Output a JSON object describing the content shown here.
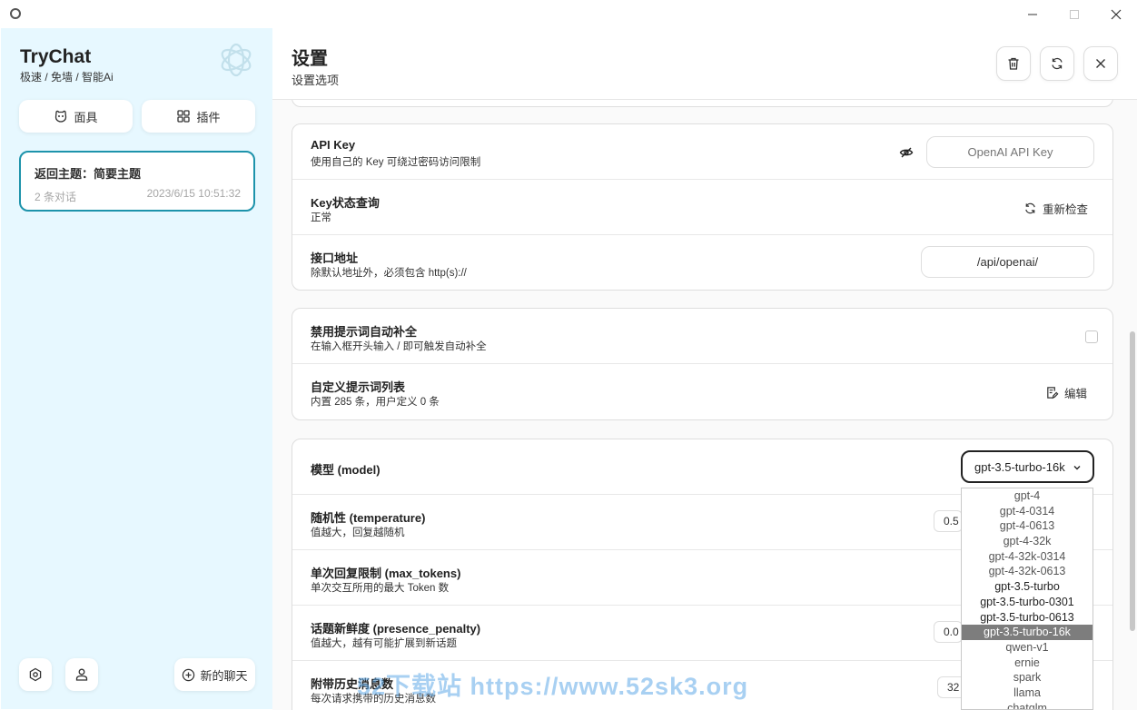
{
  "sidebar": {
    "title": "TryChat",
    "subtitle": "极速 / 免墙 / 智能Ai",
    "mask_label": "面具",
    "plugin_label": "插件",
    "chat": {
      "title": "返回主题：简要主题",
      "count": "2 条对话",
      "time": "2023/6/15 10:51:32"
    },
    "new_chat_label": "新的聊天"
  },
  "header": {
    "title": "设置",
    "subtitle": "设置选项"
  },
  "settings": {
    "api_key": {
      "title": "API Key",
      "desc": "使用自己的 Key 可绕过密码访问限制",
      "placeholder": "OpenAI API Key"
    },
    "key_status": {
      "title": "Key状态查询",
      "desc": "正常",
      "action": "重新检查"
    },
    "endpoint": {
      "title": "接口地址",
      "desc": "除默认地址外，必须包含 http(s)://",
      "value": "/api/openai/"
    },
    "disable_prompt": {
      "title": "禁用提示词自动补全",
      "desc": "在输入框开头输入 / 即可触发自动补全"
    },
    "prompt_list": {
      "title": "自定义提示词列表",
      "desc": "内置 285 条，用户定义 0 条",
      "action": "编辑"
    },
    "model": {
      "title": "模型 (model)",
      "value": "gpt-3.5-turbo-16k"
    },
    "temperature": {
      "title": "随机性 (temperature)",
      "desc": "值越大，回复越随机",
      "value": "0.5"
    },
    "max_tokens": {
      "title": "单次回复限制 (max_tokens)",
      "desc": "单次交互所用的最大 Token 数"
    },
    "presence_penalty": {
      "title": "话题新鲜度 (presence_penalty)",
      "desc": "值越大，越有可能扩展到新话题",
      "value": "0.0"
    },
    "history_count": {
      "title": "附带历史消息数",
      "desc": "每次请求携带的历史消息数",
      "value": "32"
    }
  },
  "model_options": [
    "gpt-4",
    "gpt-4-0314",
    "gpt-4-0613",
    "gpt-4-32k",
    "gpt-4-32k-0314",
    "gpt-4-32k-0613",
    "gpt-3.5-turbo",
    "gpt-3.5-turbo-0301",
    "gpt-3.5-turbo-0613",
    "gpt-3.5-turbo-16k",
    "qwen-v1",
    "ernie",
    "spark",
    "llama",
    "chatglm"
  ],
  "selected_model_index": 9,
  "watermark": "52下载站 https://www.52sk3.org"
}
